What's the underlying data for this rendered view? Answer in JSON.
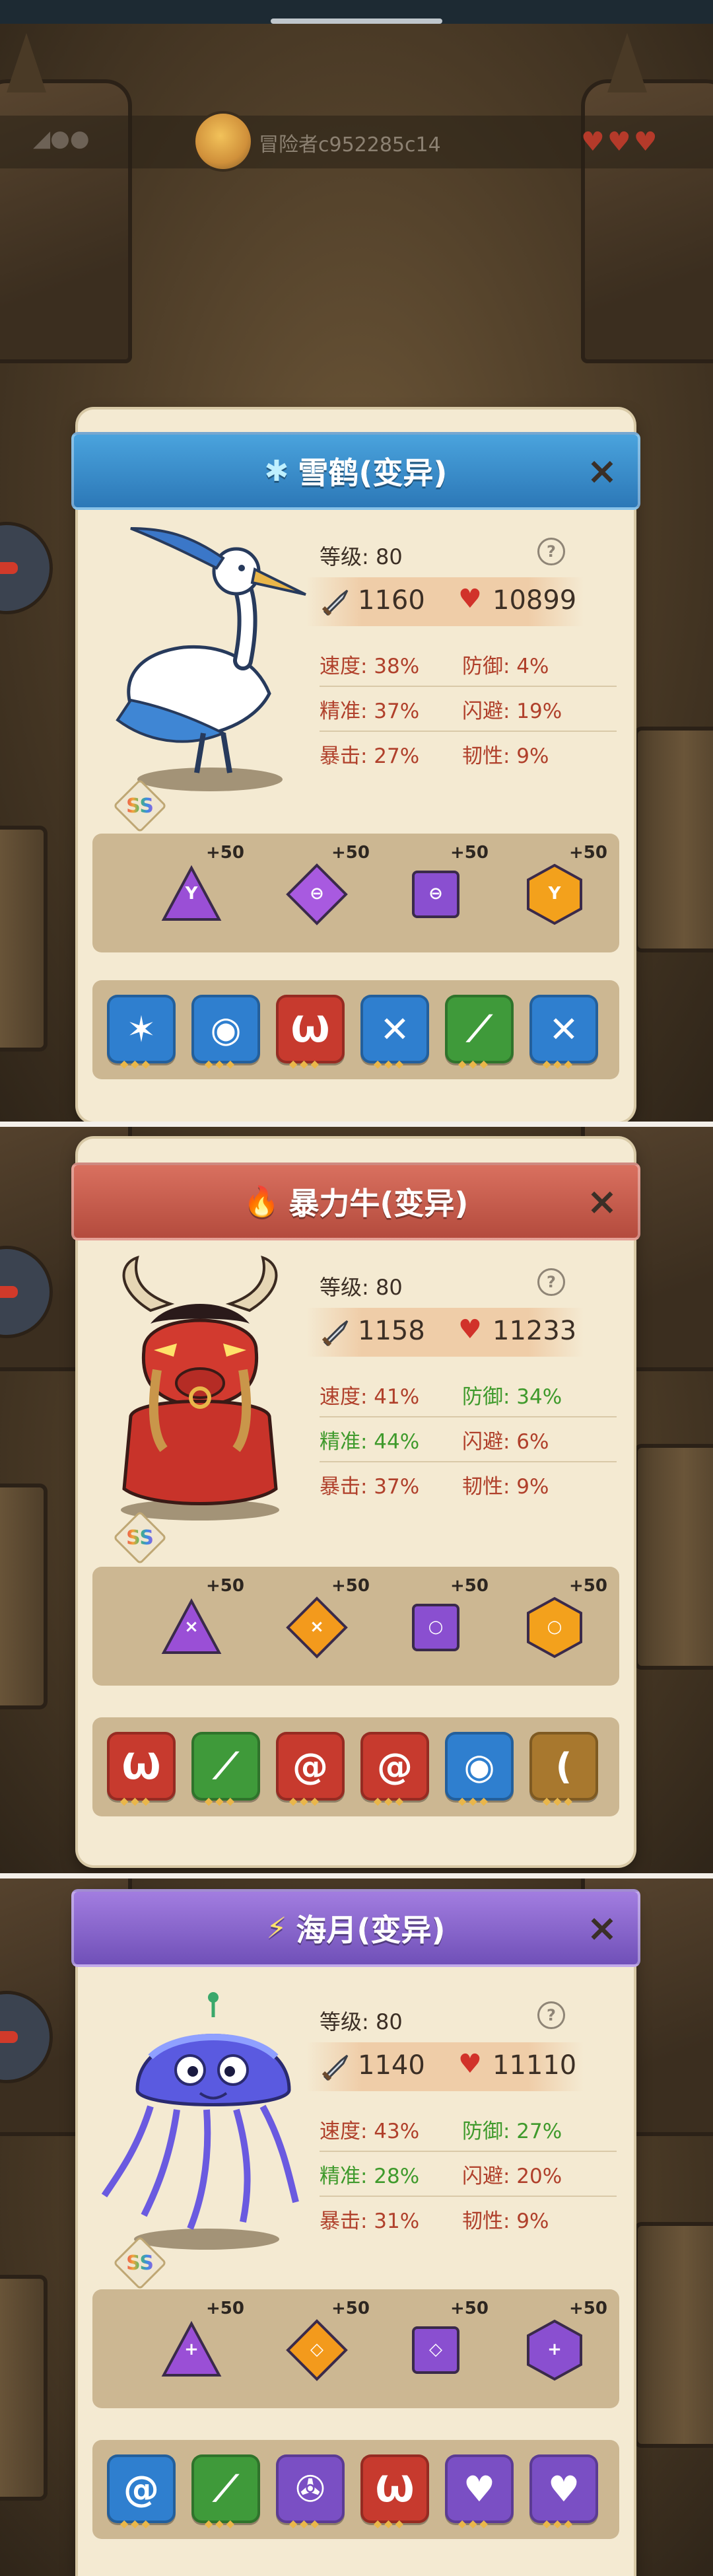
{
  "top_bar": {
    "player_name": "冒险者c952285c14",
    "signal_glyph": "◢●●",
    "hearts": "♥♥♥"
  },
  "cards": [
    {
      "name": "雪鹤(变异)",
      "element_icon": "snowflake-icon",
      "header_color": "#2c78b7",
      "grade": "SS",
      "level_label": "等级: 80",
      "attack": "1160",
      "hp": "10899",
      "stats": [
        {
          "label": "速度: 38%",
          "color": "red"
        },
        {
          "label": "防御: 4%",
          "color": "red"
        },
        {
          "label": "精准: 37%",
          "color": "red"
        },
        {
          "label": "闪避: 19%",
          "color": "red"
        },
        {
          "label": "暴击: 27%",
          "color": "red"
        },
        {
          "label": "韧性: 9%",
          "color": "red"
        }
      ],
      "runes": [
        {
          "shape": "triangle",
          "color": "#9a4fd6",
          "glyph": "Y",
          "plus": "+50"
        },
        {
          "shape": "diamond",
          "color": "#a85ae0",
          "glyph": "⊖",
          "plus": "+50"
        },
        {
          "shape": "square",
          "color": "#8a4fd0",
          "glyph": "⊖",
          "plus": "+50"
        },
        {
          "shape": "hexagon",
          "color": "#f3a11c",
          "glyph": "Y",
          "plus": "+50"
        }
      ],
      "skills": [
        {
          "icon": "claw-icon",
          "color": "#2f7fcf",
          "glyph": "✶"
        },
        {
          "icon": "eye-icon",
          "color": "#2f7fcf",
          "glyph": "◉"
        },
        {
          "icon": "fang-icon",
          "color": "#c73a2e",
          "glyph": "Ѡ"
        },
        {
          "icon": "cross-slash-icon",
          "color": "#2f7fcf",
          "glyph": "✕"
        },
        {
          "icon": "leaf-slash-icon",
          "color": "#3f9a3a",
          "glyph": "⟋"
        },
        {
          "icon": "cross-slash-icon",
          "color": "#2f7fcf",
          "glyph": "✕"
        }
      ]
    },
    {
      "name": "暴力牛(变异)",
      "element_icon": "fire-icon",
      "header_color": "#b44b3d",
      "grade": "SS",
      "level_label": "等级: 80",
      "attack": "1158",
      "hp": "11233",
      "stats": [
        {
          "label": "速度: 41%",
          "color": "red"
        },
        {
          "label": "防御: 34%",
          "color": "green"
        },
        {
          "label": "精准: 44%",
          "color": "green"
        },
        {
          "label": "闪避: 6%",
          "color": "red"
        },
        {
          "label": "暴击: 37%",
          "color": "red"
        },
        {
          "label": "韧性: 9%",
          "color": "red"
        }
      ],
      "runes": [
        {
          "shape": "triangle",
          "color": "#9a4fd6",
          "glyph": "⨯",
          "plus": "+50"
        },
        {
          "shape": "diamond",
          "color": "#f39a1c",
          "glyph": "⨯",
          "plus": "+50"
        },
        {
          "shape": "square",
          "color": "#8a4fd0",
          "glyph": "○",
          "plus": "+50"
        },
        {
          "shape": "hexagon",
          "color": "#f3a11c",
          "glyph": "○",
          "plus": "+50"
        }
      ],
      "skills": [
        {
          "icon": "fang-icon",
          "color": "#c73a2e",
          "glyph": "Ѡ"
        },
        {
          "icon": "leaf-slash-icon",
          "color": "#3f9a3a",
          "glyph": "⟋"
        },
        {
          "icon": "vortex-icon",
          "color": "#c73a2e",
          "glyph": "@"
        },
        {
          "icon": "vortex-icon",
          "color": "#c73a2e",
          "glyph": "@"
        },
        {
          "icon": "eye-icon",
          "color": "#2f7fcf",
          "glyph": "◉"
        },
        {
          "icon": "arc-wave-icon",
          "color": "#a8782e",
          "glyph": "("
        }
      ]
    },
    {
      "name": "海月(变异)",
      "element_icon": "lightning-icon",
      "header_color": "#7050b8",
      "grade": "SS",
      "level_label": "等级: 80",
      "attack": "1140",
      "hp": "11110",
      "stats": [
        {
          "label": "速度: 43%",
          "color": "red"
        },
        {
          "label": "防御: 27%",
          "color": "green"
        },
        {
          "label": "精准: 28%",
          "color": "green"
        },
        {
          "label": "闪避: 20%",
          "color": "red"
        },
        {
          "label": "暴击: 31%",
          "color": "red"
        },
        {
          "label": "韧性: 9%",
          "color": "red"
        }
      ],
      "runes": [
        {
          "shape": "triangle",
          "color": "#9a4fd6",
          "glyph": "+",
          "plus": "+50"
        },
        {
          "shape": "diamond",
          "color": "#f39a1c",
          "glyph": "◇",
          "plus": "+50"
        },
        {
          "shape": "square",
          "color": "#8a4fd0",
          "glyph": "◇",
          "plus": "+50"
        },
        {
          "shape": "hexagon",
          "color": "#8a4fd0",
          "glyph": "+",
          "plus": "+50"
        }
      ],
      "skills": [
        {
          "icon": "vortex-icon",
          "color": "#2f7fcf",
          "glyph": "@"
        },
        {
          "icon": "leaf-slash-icon",
          "color": "#3f9a3a",
          "glyph": "⟋"
        },
        {
          "icon": "radiation-icon",
          "color": "#7a4fc4",
          "glyph": "✇"
        },
        {
          "icon": "fang-icon",
          "color": "#c73a2e",
          "glyph": "Ѡ"
        },
        {
          "icon": "broken-heart-icon",
          "color": "#7a4fc4",
          "glyph": "♥"
        },
        {
          "icon": "broken-heart-icon",
          "color": "#7a4fc4",
          "glyph": "♥"
        }
      ]
    }
  ]
}
